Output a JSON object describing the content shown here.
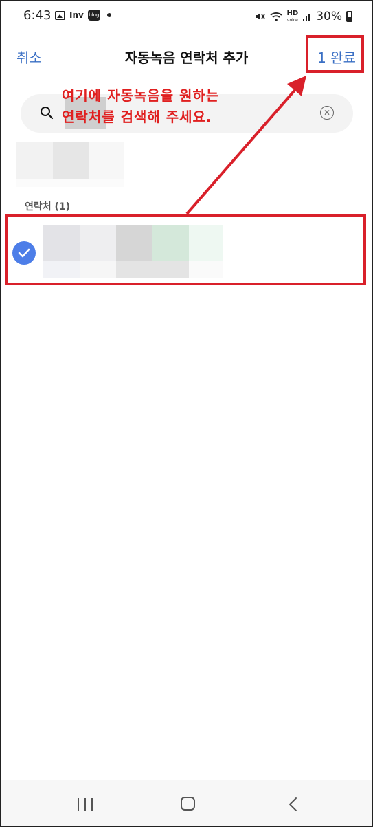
{
  "status_bar": {
    "time": "6:43",
    "inv_label": "Inv",
    "blog_label": "blog",
    "hd_label": "HD",
    "voice_label": "voice",
    "battery": "30%"
  },
  "header": {
    "cancel_label": "취소",
    "title": "자동녹음 연락처 추가",
    "done_label": "1 완료"
  },
  "search": {
    "value": "",
    "placeholder": ""
  },
  "contacts": {
    "section_label": "연락처 (1)",
    "selected_count": 1
  },
  "annotation": {
    "line1": "여기에 자동녹음을 원하는",
    "line2": "연락처를 검색해 주세요.",
    "color": "#e02020"
  },
  "colors": {
    "accent": "#3a6fc4",
    "check": "#4d7ee8",
    "highlight_box": "#d9202a"
  },
  "icons": [
    "image-icon",
    "search-icon",
    "clear-icon",
    "check-icon",
    "recent-apps-icon",
    "home-icon",
    "back-icon"
  ]
}
